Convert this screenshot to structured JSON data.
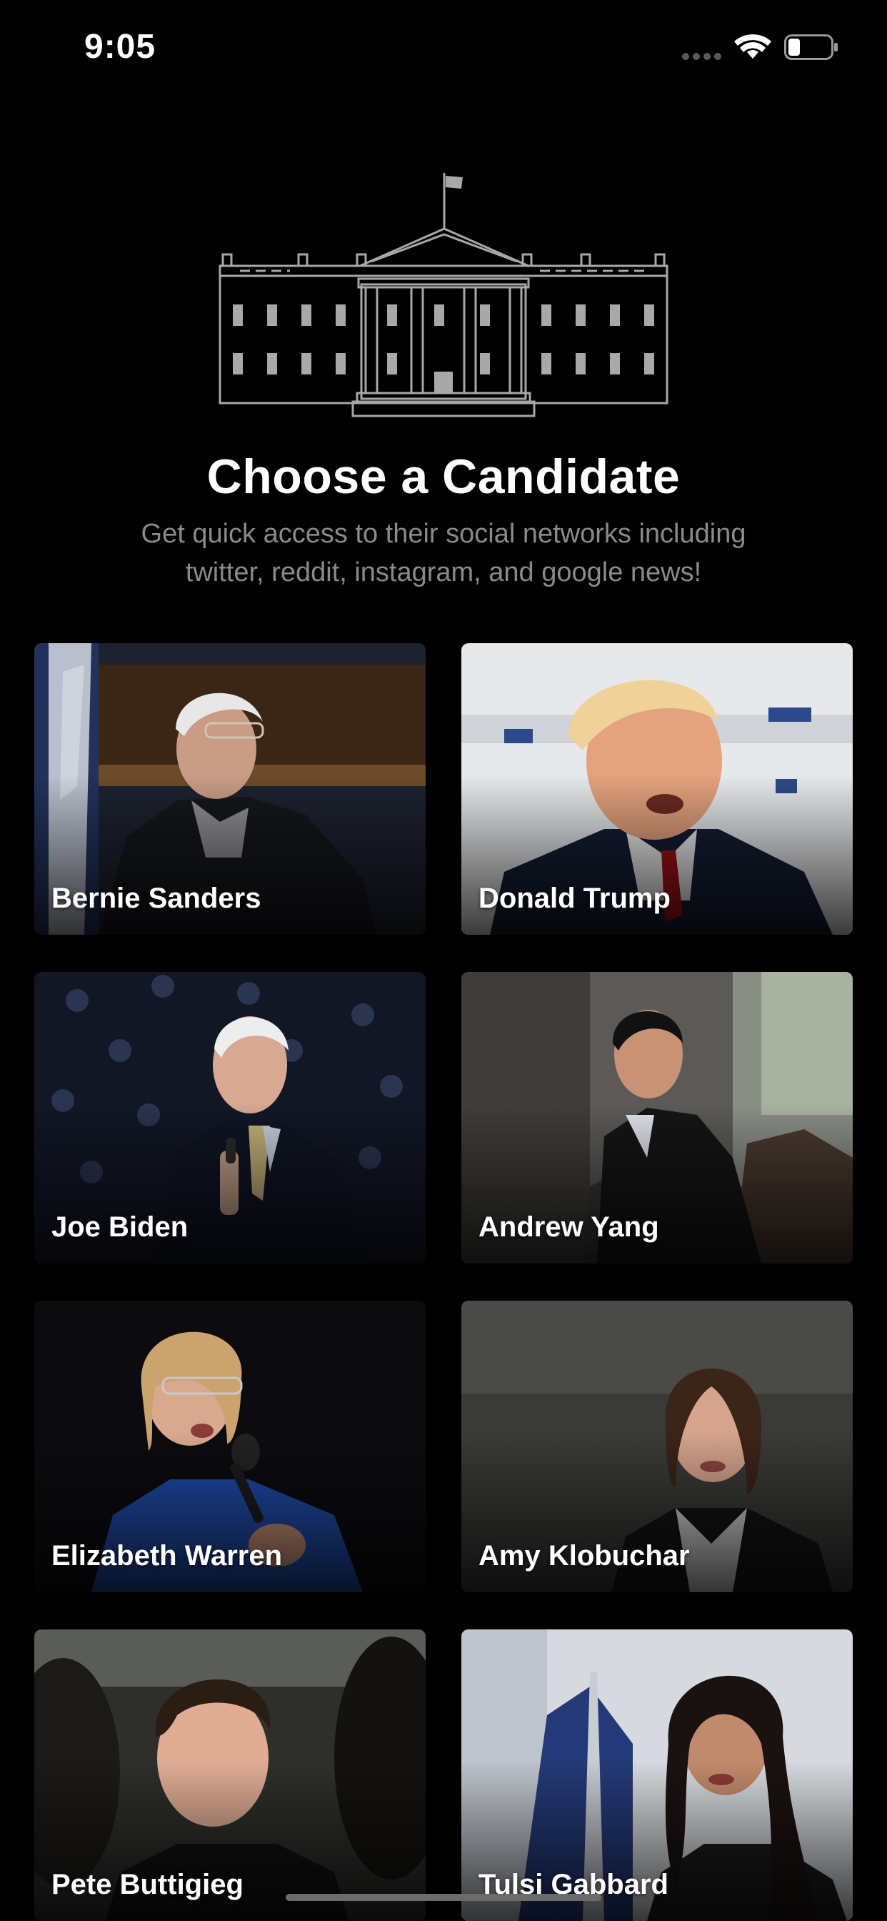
{
  "status_bar": {
    "time": "9:05"
  },
  "header": {
    "title": "Choose a Candidate",
    "subtitle": "Get quick access to their social networks including twitter, reddit, instagram, and google news!"
  },
  "candidates": [
    {
      "name": "Bernie Sanders"
    },
    {
      "name": "Donald Trump"
    },
    {
      "name": "Joe Biden"
    },
    {
      "name": "Andrew Yang"
    },
    {
      "name": "Elizabeth Warren"
    },
    {
      "name": "Amy Klobuchar"
    },
    {
      "name": "Pete Buttigieg"
    },
    {
      "name": "Tulsi Gabbard"
    }
  ],
  "icons": {
    "hero": "white-house-icon",
    "wifi": "wifi-icon",
    "battery": "battery-icon"
  }
}
